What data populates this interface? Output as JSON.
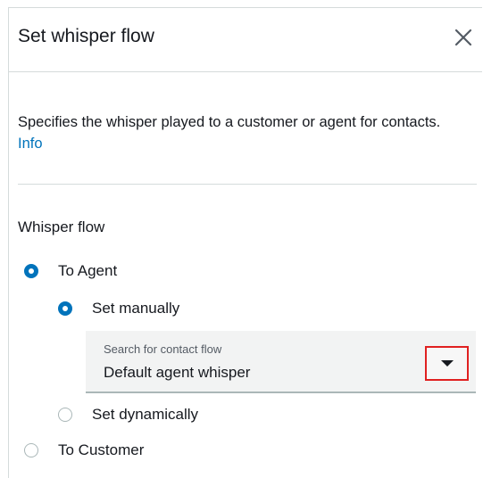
{
  "dialog": {
    "title": "Set whisper flow",
    "close_icon": "close-icon",
    "description": "Specifies the whisper played to a customer or agent for contacts.",
    "info_link": "Info"
  },
  "whisper_flow": {
    "label": "Whisper flow",
    "options": {
      "to_agent": {
        "label": "To Agent",
        "selected": true
      },
      "to_customer": {
        "label": "To Customer",
        "selected": false
      }
    },
    "agent_mode": {
      "set_manually": {
        "label": "Set manually",
        "selected": true
      },
      "set_dynamically": {
        "label": "Set dynamically",
        "selected": false
      }
    },
    "contact_flow_select": {
      "label": "Search for contact flow",
      "value": "Default agent whisper",
      "dropdown_icon": "caret-down-icon"
    }
  },
  "colors": {
    "accent": "#0073bb",
    "highlight_border": "#e02020",
    "divider": "#d5dbdb"
  }
}
